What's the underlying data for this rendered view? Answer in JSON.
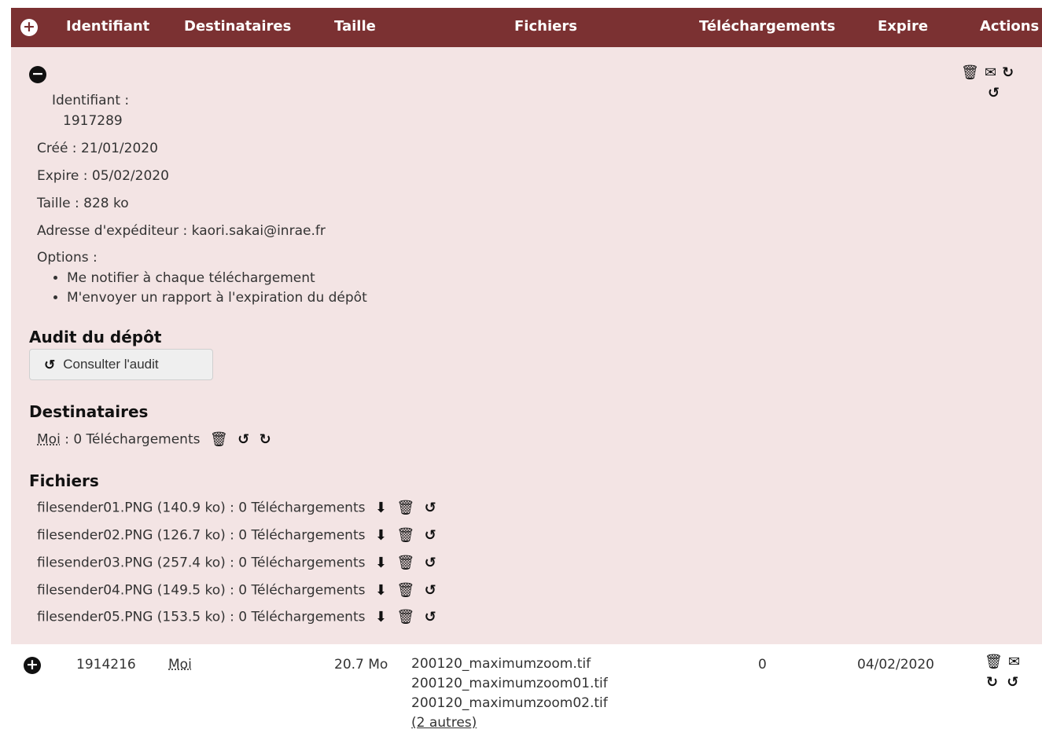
{
  "header": {
    "add_icon": "plus-circle-icon",
    "columns": {
      "identifiant": "Identifiant",
      "destinataires": "Destinataires",
      "taille": "Taille",
      "fichiers": "Fichiers",
      "telechargements": "Téléchargements",
      "expire": "Expire",
      "actions": "Actions"
    },
    "color": "#7b3132"
  },
  "expanded": {
    "collapse_icon": "minus-circle-icon",
    "actions_icons": [
      "trash-icon",
      "envelope-icon",
      "refresh-icon",
      "history-icon"
    ],
    "identifiant_label": "Identifiant :",
    "identifiant_value": "1917289",
    "created": "Créé : 21/01/2020",
    "expires": "Expire : 05/02/2020",
    "size": "Taille : 828 ko",
    "sender": "Adresse d'expéditeur : kaori.sakai@inrae.fr",
    "options_label": "Options :",
    "options": [
      "Me notifier à chaque téléchargement",
      "M'envoyer un rapport à l'expiration du dépôt"
    ],
    "audit_title": "Audit du dépôt",
    "audit_button": "Consulter l'audit",
    "recipients_title": "Destinataires",
    "recipient": {
      "name": "Moi",
      "downloads": " : 0 Téléchargements"
    },
    "files_title": "Fichiers",
    "files": [
      "filesender01.PNG (140.9 ko) : 0 Téléchargements",
      "filesender02.PNG (126.7 ko) : 0 Téléchargements",
      "filesender03.PNG (257.4 ko) : 0 Téléchargements",
      "filesender04.PNG (149.5 ko) : 0 Téléchargements",
      "filesender05.PNG (153.5 ko) : 0 Téléchargements"
    ],
    "panel_color": "#f3e4e4"
  },
  "row2": {
    "id": "1914216",
    "recipient": "Moi",
    "size": "20.7 Mo",
    "files": [
      "200120_maximumzoom.tif",
      "200120_maximumzoom01.tif",
      "200120_maximumzoom02.tif"
    ],
    "more": "(2 autres)",
    "downloads": "0",
    "expire": "04/02/2020"
  }
}
